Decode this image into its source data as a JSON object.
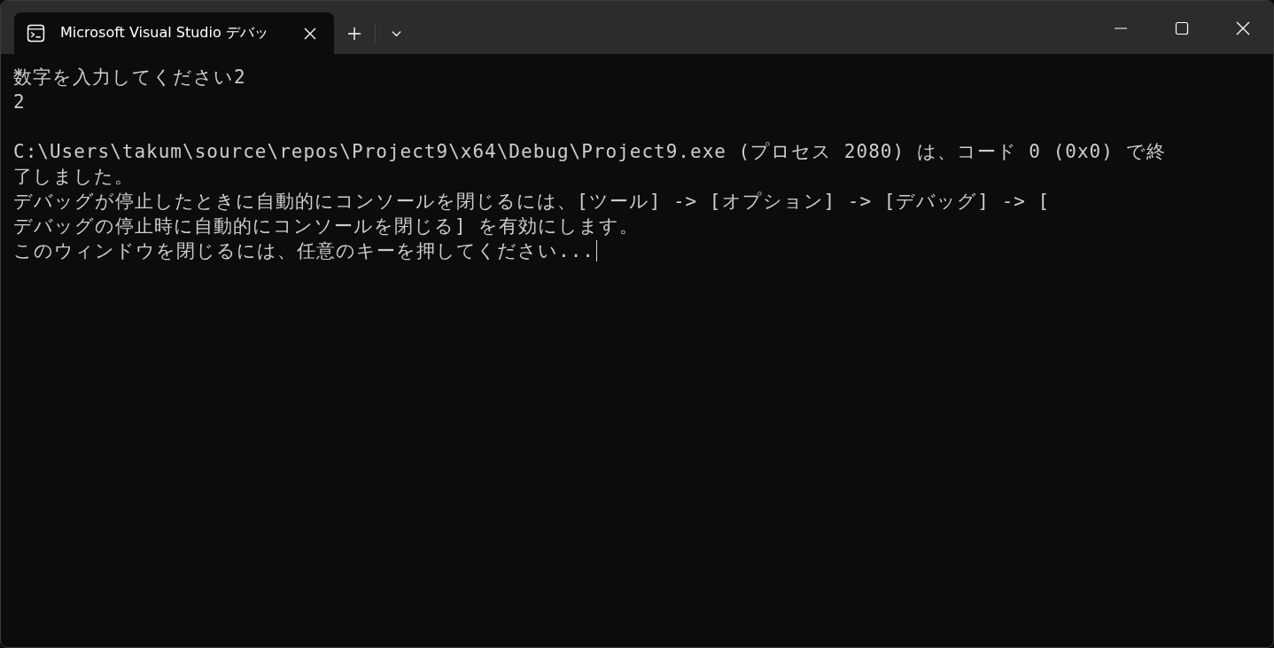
{
  "tabs": [
    {
      "title": "Microsoft Visual Studio デバッ",
      "selected": true
    }
  ],
  "console": {
    "blocks": [
      [
        "数字を入力してください2",
        "2"
      ],
      [
        "C:\\Users\\takum\\source\\repos\\Project9\\x64\\Debug\\Project9.exe (プロセス 2080) は、コード 0 (0x0) で終",
        "了しました。",
        "デバッグが停止したときに自動的にコンソールを閉じるには、[ツール] -> [オプション] -> [デバッグ] -> [",
        "デバッグの停止時に自動的にコンソールを閉じる] を有効にします。",
        "このウィンドウを閉じるには、任意のキーを押してください..."
      ]
    ]
  }
}
